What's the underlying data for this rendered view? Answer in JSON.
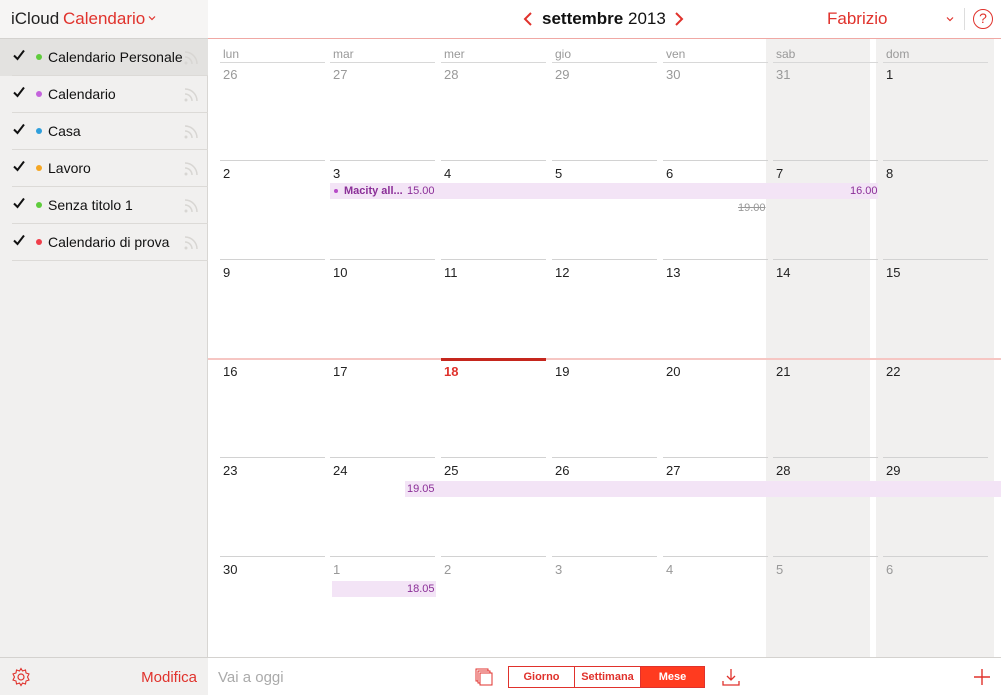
{
  "sidebar": {
    "brand": "iCloud",
    "app_name": "Calendario",
    "calendars": [
      {
        "name": "Calendario Personale",
        "color": "#5fcc3c",
        "checked": true,
        "selected": true
      },
      {
        "name": "Calendario",
        "color": "#c463dc",
        "checked": true,
        "selected": false
      },
      {
        "name": "Casa",
        "color": "#2f9fdc",
        "checked": true,
        "selected": false
      },
      {
        "name": "Lavoro",
        "color": "#f5a623",
        "checked": true,
        "selected": false
      },
      {
        "name": "Senza titolo 1",
        "color": "#5fcc3c",
        "checked": true,
        "selected": false
      },
      {
        "name": "Calendario di prova",
        "color": "#f03e4a",
        "checked": true,
        "selected": false
      }
    ],
    "edit_label": "Modifica"
  },
  "header": {
    "month": "settembre",
    "year": "2013",
    "user": "Fabrizio",
    "help": "?"
  },
  "calendar": {
    "weekdays": [
      "lun",
      "mar",
      "mer",
      "gio",
      "ven",
      "sab",
      "dom"
    ],
    "weeks": [
      [
        {
          "d": "26",
          "dim": true
        },
        {
          "d": "27",
          "dim": true
        },
        {
          "d": "28",
          "dim": true
        },
        {
          "d": "29",
          "dim": true
        },
        {
          "d": "30",
          "dim": true
        },
        {
          "d": "31",
          "dim": true
        },
        {
          "d": "1",
          "dim": false
        }
      ],
      [
        {
          "d": "2",
          "dim": false
        },
        {
          "d": "3",
          "dim": false
        },
        {
          "d": "4",
          "dim": false
        },
        {
          "d": "5",
          "dim": false
        },
        {
          "d": "6",
          "dim": false
        },
        {
          "d": "7",
          "dim": false
        },
        {
          "d": "8",
          "dim": false
        }
      ],
      [
        {
          "d": "9",
          "dim": false
        },
        {
          "d": "10",
          "dim": false
        },
        {
          "d": "11",
          "dim": false
        },
        {
          "d": "12",
          "dim": false
        },
        {
          "d": "13",
          "dim": false
        },
        {
          "d": "14",
          "dim": false
        },
        {
          "d": "15",
          "dim": false
        }
      ],
      [
        {
          "d": "16",
          "dim": false
        },
        {
          "d": "17",
          "dim": false
        },
        {
          "d": "18",
          "dim": false,
          "today": true
        },
        {
          "d": "19",
          "dim": false
        },
        {
          "d": "20",
          "dim": false
        },
        {
          "d": "21",
          "dim": false
        },
        {
          "d": "22",
          "dim": false
        }
      ],
      [
        {
          "d": "23",
          "dim": false
        },
        {
          "d": "24",
          "dim": false
        },
        {
          "d": "25",
          "dim": false
        },
        {
          "d": "26",
          "dim": false
        },
        {
          "d": "27",
          "dim": false
        },
        {
          "d": "28",
          "dim": false
        },
        {
          "d": "29",
          "dim": false
        }
      ],
      [
        {
          "d": "30",
          "dim": false
        },
        {
          "d": "1",
          "dim": true
        },
        {
          "d": "2",
          "dim": true
        },
        {
          "d": "3",
          "dim": true
        },
        {
          "d": "4",
          "dim": true
        },
        {
          "d": "5",
          "dim": true
        },
        {
          "d": "6",
          "dim": true
        }
      ]
    ],
    "events": [
      {
        "title": "Macity all...",
        "start_time": "15.00",
        "end_time": "16.00"
      },
      {
        "faint_time": "19.00"
      },
      {
        "start_time": "19.05"
      },
      {
        "start_time": "18.05"
      }
    ],
    "event_color": "#f3e4f6"
  },
  "footer": {
    "today_label": "Vai a oggi",
    "views": [
      "Giorno",
      "Settimana",
      "Mese"
    ],
    "active_view": "Mese"
  }
}
